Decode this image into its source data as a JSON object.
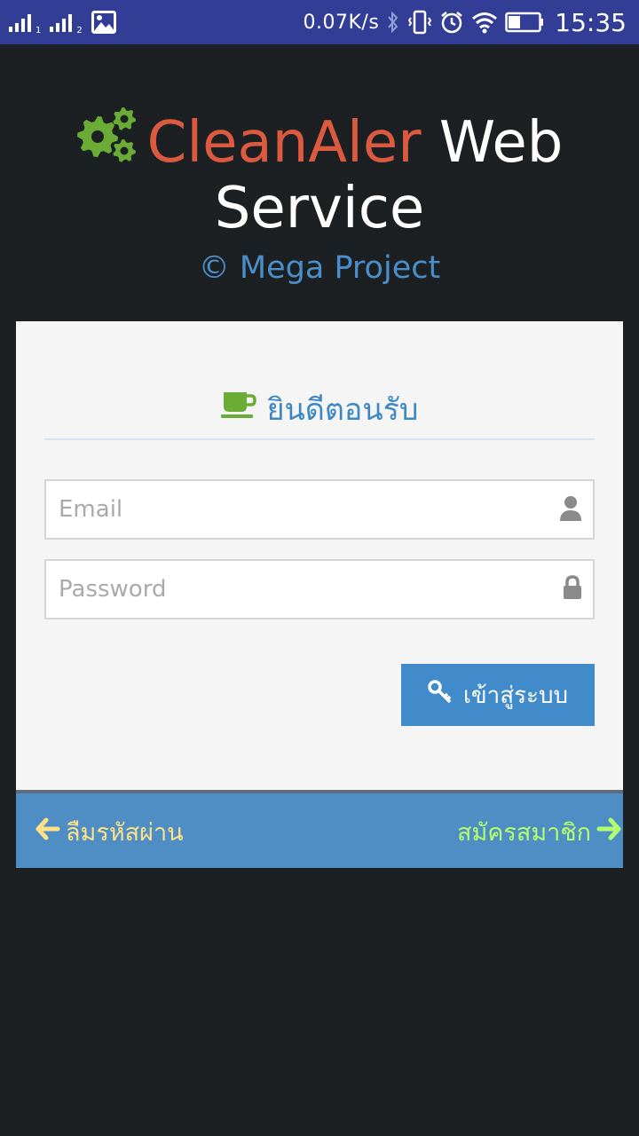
{
  "status_bar": {
    "sim1_label": "1",
    "sim2_label": "2",
    "net_speed": "0.07K/s",
    "time": "15:35",
    "battery_level": 0.4
  },
  "brand": {
    "name_part1": "CleanAler",
    "name_part2": "Web",
    "name_part3": "Service",
    "copyright": "© Mega Project",
    "accent_color": "#dc5a40",
    "gear_color": "#6aac36"
  },
  "login_card": {
    "title": "ยินดีตอนรับ",
    "email_placeholder": "Email",
    "email_value": "",
    "password_placeholder": "Password",
    "password_value": "",
    "login_label": "เข้าสู่ระบบ"
  },
  "footer": {
    "forgot_label": "ลืมรหัสผ่าน",
    "register_label": "สมัครสมาชิก"
  }
}
